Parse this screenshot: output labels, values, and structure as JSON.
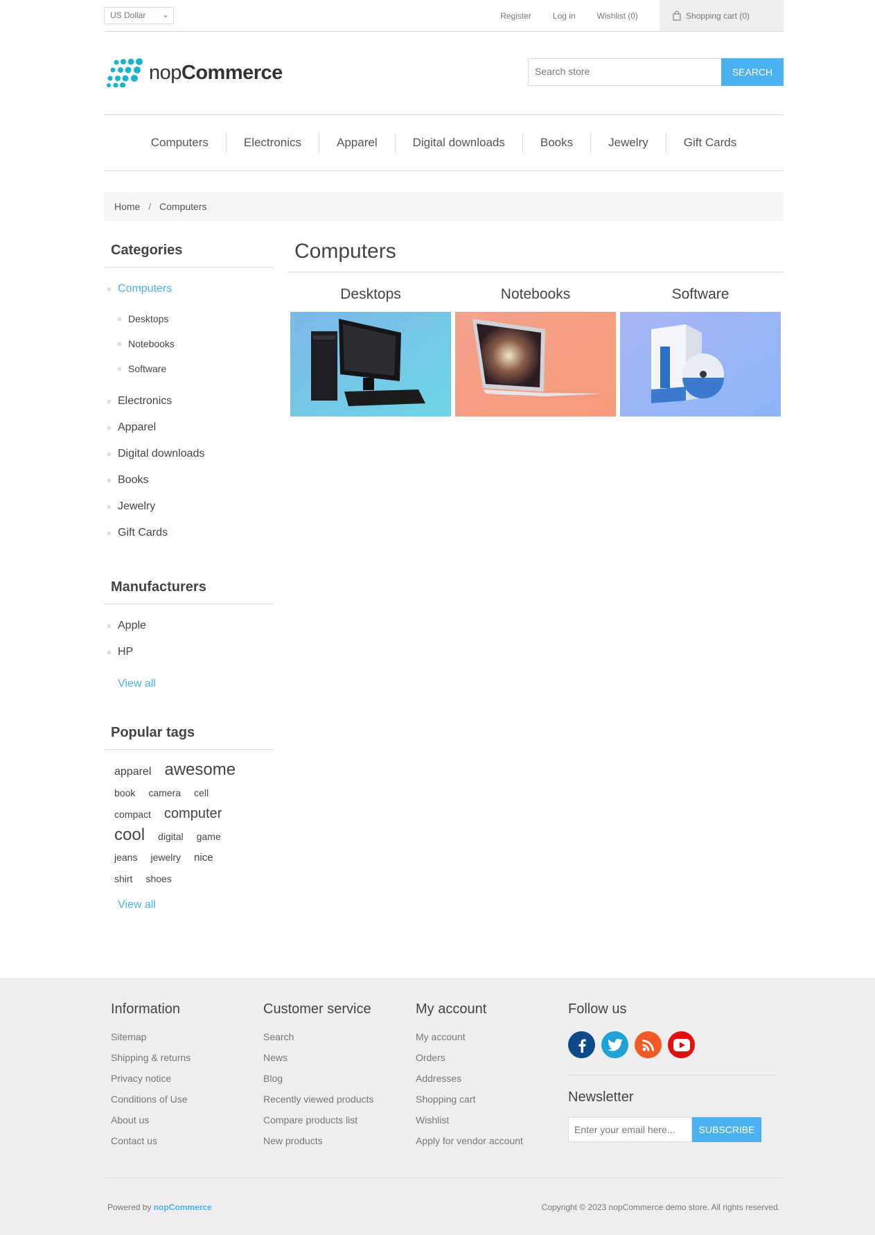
{
  "header": {
    "currency": "US Dollar",
    "links": [
      "Register",
      "Log in",
      "Wishlist (0)"
    ],
    "cart": "Shopping cart (0)"
  },
  "logo": {
    "prefix": "nop",
    "suffix": "Commerce"
  },
  "search": {
    "placeholder": "Search store",
    "button": "SEARCH"
  },
  "topmenu": [
    "Computers",
    "Electronics",
    "Apparel",
    "Digital downloads",
    "Books",
    "Jewelry",
    "Gift Cards"
  ],
  "breadcrumb": {
    "home": "Home",
    "separator": "/",
    "current": "Computers"
  },
  "categories": {
    "title": "Categories",
    "active": "Computers",
    "sub": [
      "Desktops",
      "Notebooks",
      "Software"
    ],
    "others": [
      "Electronics",
      "Apparel",
      "Digital downloads",
      "Books",
      "Jewelry",
      "Gift Cards"
    ]
  },
  "manufacturers": {
    "title": "Manufacturers",
    "items": [
      "Apple",
      "HP"
    ],
    "view_all": "View all"
  },
  "tags": {
    "title": "Popular tags",
    "items": [
      {
        "label": "apparel",
        "size": 16
      },
      {
        "label": "awesome",
        "size": 24
      },
      {
        "label": "book",
        "size": 14
      },
      {
        "label": "camera",
        "size": 14
      },
      {
        "label": "cell",
        "size": 14
      },
      {
        "label": "compact",
        "size": 14
      },
      {
        "label": "computer",
        "size": 20
      },
      {
        "label": "cool",
        "size": 24
      },
      {
        "label": "digital",
        "size": 14
      },
      {
        "label": "game",
        "size": 14
      },
      {
        "label": "jeans",
        "size": 14
      },
      {
        "label": "jewelry",
        "size": 14
      },
      {
        "label": "nice",
        "size": 15
      },
      {
        "label": "shirt",
        "size": 14
      },
      {
        "label": "shoes",
        "size": 14
      }
    ],
    "view_all": "View all"
  },
  "main": {
    "title": "Computers",
    "subcategories": [
      "Desktops",
      "Notebooks",
      "Software"
    ]
  },
  "footer": {
    "information": {
      "title": "Information",
      "items": [
        "Sitemap",
        "Shipping & returns",
        "Privacy notice",
        "Conditions of Use",
        "About us",
        "Contact us"
      ]
    },
    "customer_service": {
      "title": "Customer service",
      "items": [
        "Search",
        "News",
        "Blog",
        "Recently viewed products",
        "Compare products list",
        "New products"
      ]
    },
    "my_account": {
      "title": "My account",
      "items": [
        "My account",
        "Orders",
        "Addresses",
        "Shopping cart",
        "Wishlist",
        "Apply for vendor account"
      ]
    },
    "follow": {
      "title": "Follow us",
      "icons": [
        "facebook-icon",
        "twitter-icon",
        "rss-icon",
        "youtube-icon"
      ]
    },
    "newsletter": {
      "title": "Newsletter",
      "placeholder": "Enter your email here...",
      "button": "SUBSCRIBE"
    },
    "powered_prefix": "Powered by",
    "powered_brand": "nopCommerce",
    "copyright": "Copyright © 2023 nopCommerce demo store. All rights reserved."
  },
  "colors": {
    "accent": "#4ab2f1",
    "footer_bg": "#eeeeee",
    "logo_dots": "#1ab3cf"
  }
}
